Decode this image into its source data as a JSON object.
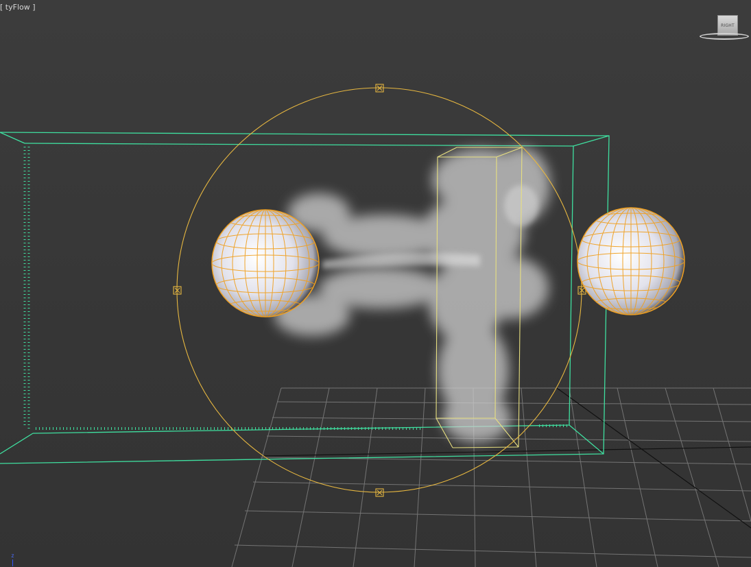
{
  "viewport": {
    "label": "[ tyFlow ]",
    "background": "#3a3a3a"
  },
  "viewcube": {
    "face_label": "RIGHT"
  },
  "axis_tripod": {
    "z_label": "z"
  },
  "colors": {
    "grid": "#8a8a8a",
    "grid_axis": "#111111",
    "bounds_box": "#3fe0a0",
    "selection": "#e8b840",
    "sphere_wire": "#f0a020",
    "sphere_fill": "#e4e4ee",
    "smoke": "#cfcfcf"
  },
  "objects": [
    {
      "name": "sphere-left",
      "type": "sphere",
      "selected": true
    },
    {
      "name": "sphere-right",
      "type": "sphere",
      "selected": true
    },
    {
      "name": "box-collider",
      "type": "box",
      "selected": true
    },
    {
      "name": "radius-gizmo",
      "type": "sphere-gizmo",
      "selected": true
    },
    {
      "name": "sim-bounds",
      "type": "bounding-box",
      "selected": false
    },
    {
      "name": "smoke-volume",
      "type": "particles",
      "selected": false
    }
  ]
}
